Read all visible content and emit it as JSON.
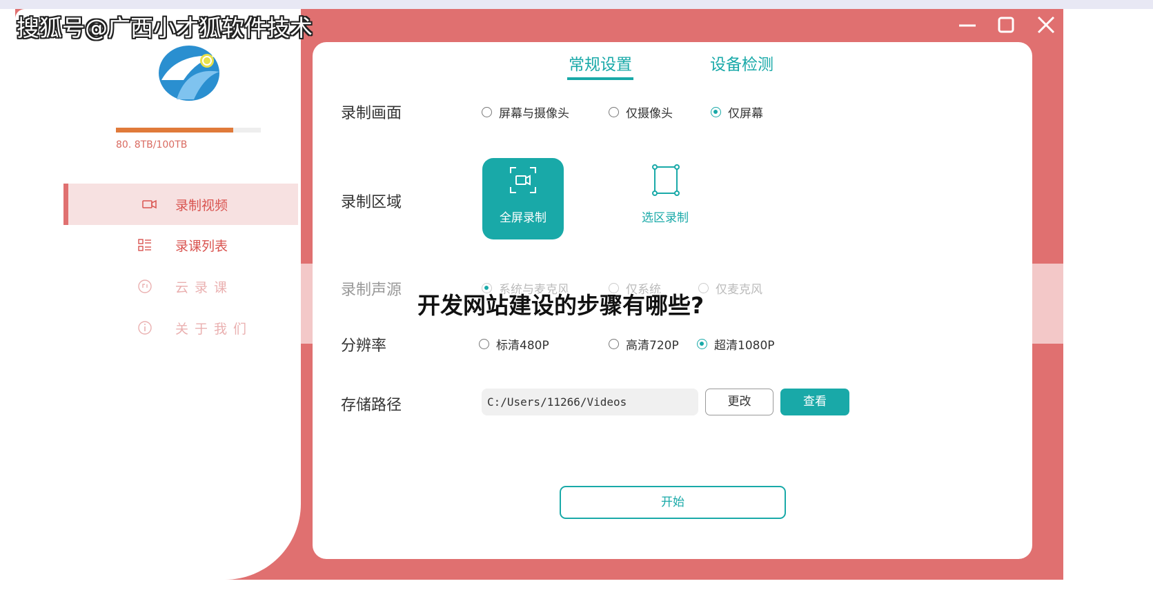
{
  "watermark": "搜狐号@广西小才狐软件技术",
  "overlay_title": "开发网站建设的步骤有哪些?",
  "storage": {
    "used_text": "80. 8TB/100TB",
    "used_fraction": 0.81
  },
  "sidebar": {
    "items": [
      {
        "label": "录制视频",
        "icon": "video-camera-icon",
        "active": true
      },
      {
        "label": "录课列表",
        "icon": "list-icon",
        "active": false
      },
      {
        "label": "云录课",
        "icon": "cloud-icon",
        "active": false
      },
      {
        "label": "关于我们",
        "icon": "info-icon",
        "active": false
      }
    ]
  },
  "window_controls": {
    "minimize": "minimize-icon",
    "maximize": "maximize-icon",
    "close": "close-icon"
  },
  "tabs": [
    {
      "label": "常规设置",
      "active": true
    },
    {
      "label": "设备检测",
      "active": false
    }
  ],
  "settings": {
    "record_screen": {
      "label": "录制画面",
      "options": [
        "屏幕与摄像头",
        "仅摄像头",
        "仅屏幕"
      ],
      "selected": "仅屏幕"
    },
    "record_area": {
      "label": "录制区域",
      "full": "全屏录制",
      "select": "选区录制",
      "selected": "全屏录制"
    },
    "audio_source": {
      "label": "录制声源",
      "options": [
        "系统与麦克风",
        "仅系统",
        "仅麦克风"
      ],
      "selected": "系统与麦克风"
    },
    "resolution": {
      "label": "分辨率",
      "options": [
        "标清480P",
        "高清720P",
        "超清1080P"
      ],
      "selected": "超清1080P"
    },
    "storage_path": {
      "label": "存储路径",
      "value": "C:/Users/11266/Videos",
      "change": "更改",
      "view": "查看"
    }
  },
  "start_button": "开始",
  "colors": {
    "accent": "#19a9a8",
    "frame": "#e07070",
    "sidebar_text": "#d9534f",
    "progress": "#e07a3a"
  }
}
